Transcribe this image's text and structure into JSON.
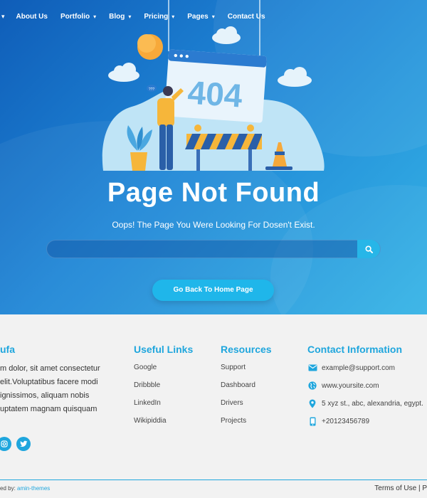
{
  "nav": {
    "items": [
      {
        "label": "About Us"
      },
      {
        "label": "Portfolio"
      },
      {
        "label": "Blog"
      },
      {
        "label": "Pricing"
      },
      {
        "label": "Pages"
      },
      {
        "label": "Contact Us"
      }
    ]
  },
  "illustration": {
    "error_code": "404",
    "bubble_text": "???"
  },
  "hero": {
    "title": "Page Not Found",
    "subtitle": "Oops! The Page You Were Looking For Dosen't Exist.",
    "search_placeholder": "",
    "home_button": "Go Back To Home Page"
  },
  "footer": {
    "about": {
      "title_fragment": "ufa",
      "lines": [
        "m dolor, sit amet consectetur",
        "elit.Voluptatibus facere modi",
        "ignissimos, aliquam nobis",
        "uptatem magnam quisquam"
      ]
    },
    "useful_links": {
      "title": "Useful Links",
      "items": [
        "Google",
        "Dribbble",
        "LinkedIn",
        "Wikipiddia"
      ]
    },
    "resources": {
      "title": "Resources",
      "items": [
        "Support",
        "Dashboard",
        "Drivers",
        "Projects"
      ]
    },
    "contact": {
      "title": "Contact Information",
      "email": "example@support.com",
      "website": "www.yoursite.com",
      "address": "5 xyz st., abc, alexandria, egypt.",
      "phone": "+20123456789"
    },
    "credit_prefix": "ed by:",
    "credit_link": "amin-themes",
    "bottom_links": "Terms of Use | P"
  },
  "colors": {
    "accent": "#1fa6dd",
    "hero_dark": "#0f5db8",
    "hero_light": "#36b4e6",
    "button": "#1fb6ea"
  },
  "icons": [
    "chevron-down-icon",
    "search-icon",
    "email-icon",
    "globe-icon",
    "location-pin-icon",
    "phone-icon",
    "instagram-icon",
    "twitter-icon"
  ]
}
